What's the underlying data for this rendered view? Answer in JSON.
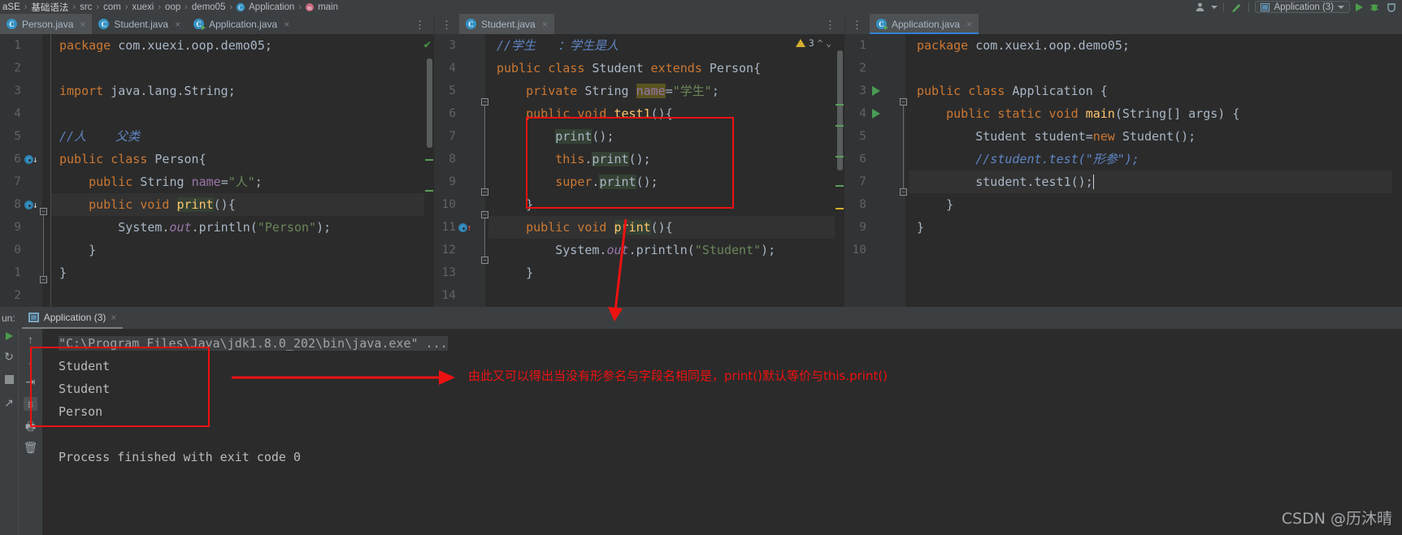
{
  "breadcrumb": {
    "items": [
      {
        "label": "aSE",
        "icon": "project-icon"
      },
      {
        "label": "基础语法",
        "icon": "module-icon"
      },
      {
        "label": "src",
        "icon": "folder-icon"
      },
      {
        "label": "com",
        "icon": "package-icon"
      },
      {
        "label": "xuexi",
        "icon": "package-icon"
      },
      {
        "label": "oop",
        "icon": "package-icon"
      },
      {
        "label": "demo05",
        "icon": "package-icon"
      },
      {
        "label": "Application",
        "icon": "class-icon"
      },
      {
        "label": "main",
        "icon": "method-icon"
      }
    ],
    "separator": "›"
  },
  "toolbar": {
    "profile_icon": "user-icon",
    "build_icon": "hammer-icon",
    "run_config": "Application (3)",
    "run_button": "run-icon",
    "debug_button": "debug-icon",
    "coverage_button": "coverage-icon"
  },
  "panes": {
    "left": {
      "tabs": [
        {
          "label": "Person.java",
          "icon": "java-class-icon",
          "active": true,
          "close": "×"
        },
        {
          "label": "Student.java",
          "icon": "java-class-icon",
          "active": false,
          "close": "×"
        },
        {
          "label": "Application.java",
          "icon": "java-runnable-icon",
          "active": false,
          "close": "×"
        }
      ],
      "menu_glyph": "⋮",
      "inspection_status": "✔",
      "lines": [
        {
          "num": "1",
          "text": "package com.xuexi.oop.demo05;"
        },
        {
          "num": "2",
          "text": ""
        },
        {
          "num": "3",
          "text": "import java.lang.String;"
        },
        {
          "num": "4",
          "text": ""
        },
        {
          "num": "5",
          "text": "//人    父类"
        },
        {
          "num": "6",
          "text": "public class Person{"
        },
        {
          "num": "7",
          "text": "    public String name=\"人\";"
        },
        {
          "num": "8",
          "text": "    public void print(){"
        },
        {
          "num": "9",
          "text": "        System.out.println(\"Person\");"
        },
        {
          "num": "0",
          "text": "    }"
        },
        {
          "num": "1",
          "text": "}"
        },
        {
          "num": "2",
          "text": ""
        }
      ]
    },
    "middle": {
      "tabs": [
        {
          "label": "Student.java",
          "icon": "java-class-icon",
          "active": true,
          "close": "×"
        }
      ],
      "menu_glyph": "⋮",
      "warning_count": "3",
      "warning_icon": "warning-triangle-icon",
      "prev_glyph": "^",
      "next_glyph": "⌄",
      "lines": [
        {
          "num": "3",
          "text": "//学生   ：学生是人"
        },
        {
          "num": "4",
          "text": "public class Student extends Person{"
        },
        {
          "num": "5",
          "text": "    private String name=\"学生\";"
        },
        {
          "num": "6",
          "text": "    public void test1(){"
        },
        {
          "num": "7",
          "text": "        print();"
        },
        {
          "num": "8",
          "text": "        this.print();"
        },
        {
          "num": "9",
          "text": "        super.print();"
        },
        {
          "num": "10",
          "text": "    }"
        },
        {
          "num": "11",
          "text": "    public void print(){"
        },
        {
          "num": "12",
          "text": "        System.out.println(\"Student\");"
        },
        {
          "num": "13",
          "text": "    }"
        },
        {
          "num": "14",
          "text": ""
        }
      ]
    },
    "right": {
      "tabs": [
        {
          "label": "Application.java",
          "icon": "java-runnable-icon",
          "active": true,
          "close": "×"
        }
      ],
      "lines": [
        {
          "num": "1",
          "text": "package com.xuexi.oop.demo05;"
        },
        {
          "num": "2",
          "text": ""
        },
        {
          "num": "3",
          "text": "public class Application {"
        },
        {
          "num": "4",
          "text": "    public static void main(String[] args) {"
        },
        {
          "num": "5",
          "text": "        Student student=new Student();"
        },
        {
          "num": "6",
          "text": "        //student.test(\"形参\");"
        },
        {
          "num": "7",
          "text": "        student.test1();"
        },
        {
          "num": "8",
          "text": "    }"
        },
        {
          "num": "9",
          "text": "}"
        },
        {
          "num": "10",
          "text": ""
        }
      ]
    }
  },
  "run_panel": {
    "label": "un:",
    "tab_label": "Application (3)",
    "tab_icon": "console-icon",
    "tab_close": "×",
    "sidebar_icons": [
      "run-icon",
      "rerun-icon",
      "stop-icon",
      "scroll-icon"
    ],
    "toolbar_icons": [
      "up-arrow-icon",
      "down-arrow-icon",
      "soft-wrap-icon",
      "scroll-to-end-icon",
      "print-icon",
      "trash-icon"
    ],
    "console_lines": [
      {
        "text": "\"C:\\Program Files\\Java\\jdk1.8.0_202\\bin\\java.exe\" ...",
        "command": true
      },
      {
        "text": "Student",
        "command": false
      },
      {
        "text": "Student",
        "command": false
      },
      {
        "text": "Person",
        "command": false
      },
      {
        "text": "",
        "command": false
      },
      {
        "text": "Process finished with exit code 0",
        "command": false
      }
    ]
  },
  "annotations": {
    "note_text": "由此又可以得出当没有形参名与字段名相同是，print()默认等价与this.print()",
    "color": "#ee1111"
  },
  "watermark": "CSDN @历沐晴"
}
